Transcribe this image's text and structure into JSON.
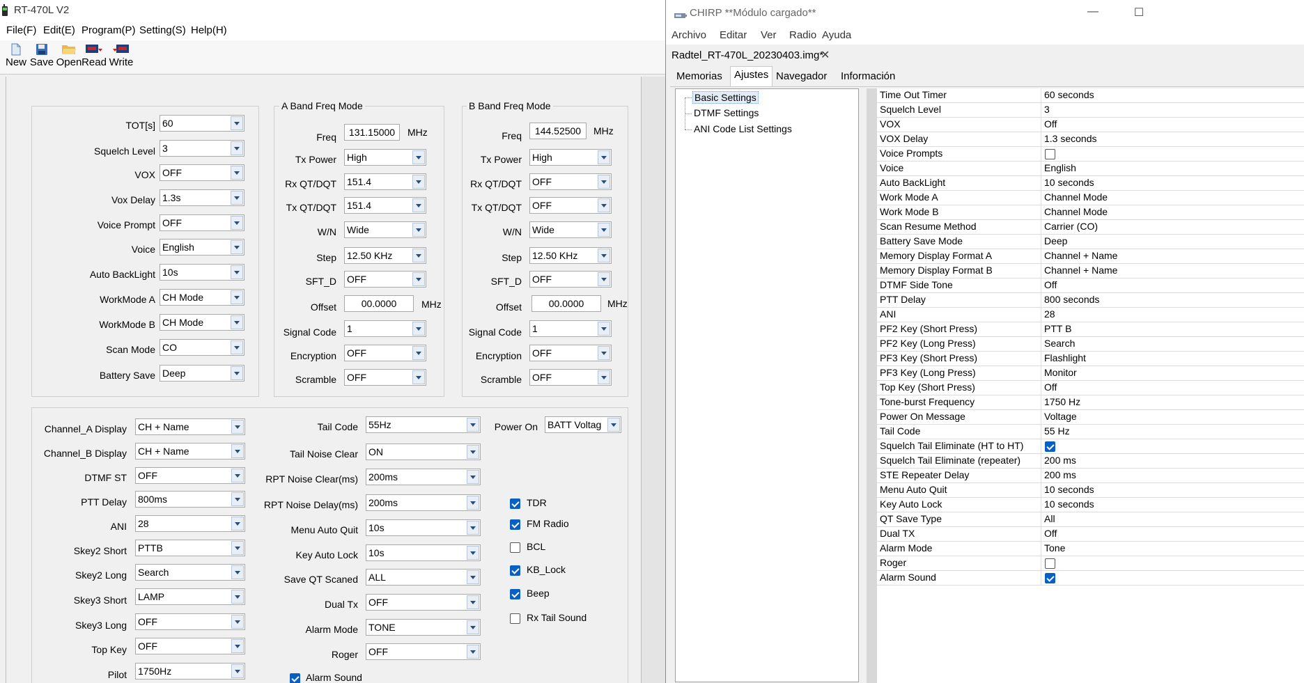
{
  "rt": {
    "title": "RT-470L V2",
    "menu": [
      "File(F)",
      "Edit(E)",
      "Program(P)",
      "Setting(S)",
      "Help(H)"
    ],
    "toolbar": [
      "New",
      "Save",
      "Open",
      "Read",
      "Write"
    ],
    "general": {
      "tot": {
        "label": "TOT[s]",
        "value": "60"
      },
      "squelch": {
        "label": "Squelch Level",
        "value": "3"
      },
      "vox": {
        "label": "VOX",
        "value": "OFF"
      },
      "vox_delay": {
        "label": "Vox Delay",
        "value": "1.3s"
      },
      "voice_prompt": {
        "label": "Voice Prompt",
        "value": "OFF"
      },
      "voice": {
        "label": "Voice",
        "value": "English"
      },
      "backlight": {
        "label": "Auto BackLight",
        "value": "10s"
      },
      "workmode_a": {
        "label": "WorkMode A",
        "value": "CH Mode"
      },
      "workmode_b": {
        "label": "WorkMode B",
        "value": "CH Mode"
      },
      "scan_mode": {
        "label": "Scan Mode",
        "value": "CO"
      },
      "battery_save": {
        "label": "Battery Save",
        "value": "Deep"
      }
    },
    "band_a": {
      "title": "A Band Freq Mode",
      "freq": {
        "label": "Freq",
        "value": "131.15000",
        "unit": "MHz"
      },
      "tx_power": {
        "label": "Tx Power",
        "value": "High"
      },
      "rx_qt": {
        "label": "Rx QT/DQT",
        "value": "151.4"
      },
      "tx_qt": {
        "label": "Tx QT/DQT",
        "value": "151.4"
      },
      "wn": {
        "label": "W/N",
        "value": "Wide"
      },
      "step": {
        "label": "Step",
        "value": "12.50 KHz"
      },
      "sft_d": {
        "label": "SFT_D",
        "value": "OFF"
      },
      "offset": {
        "label": "Offset",
        "value": "00.0000",
        "unit": "MHz"
      },
      "signal_code": {
        "label": "Signal Code",
        "value": "1"
      },
      "encryption": {
        "label": "Encryption",
        "value": "OFF"
      },
      "scramble": {
        "label": "Scramble",
        "value": "OFF"
      }
    },
    "band_b": {
      "title": "B Band Freq Mode",
      "freq": {
        "label": "Freq",
        "value": "144.52500",
        "unit": "MHz"
      },
      "tx_power": {
        "label": "Tx Power",
        "value": "High"
      },
      "rx_qt": {
        "label": "Rx QT/DQT",
        "value": "OFF"
      },
      "tx_qt": {
        "label": "Tx QT/DQT",
        "value": "OFF"
      },
      "wn": {
        "label": "W/N",
        "value": "Wide"
      },
      "step": {
        "label": "Step",
        "value": "12.50 KHz"
      },
      "sft_d": {
        "label": "SFT_D",
        "value": "OFF"
      },
      "offset": {
        "label": "Offset",
        "value": "00.0000",
        "unit": "MHz"
      },
      "signal_code": {
        "label": "Signal Code",
        "value": "1"
      },
      "encryption": {
        "label": "Encryption",
        "value": "OFF"
      },
      "scramble": {
        "label": "Scramble",
        "value": "OFF"
      }
    },
    "func_left": {
      "ch_a_display": {
        "label": "Channel_A Display",
        "value": "CH + Name"
      },
      "ch_b_display": {
        "label": "Channel_B Display",
        "value": "CH + Name"
      },
      "dtmf_st": {
        "label": "DTMF ST",
        "value": "OFF"
      },
      "ptt_delay": {
        "label": "PTT Delay",
        "value": "800ms"
      },
      "ani": {
        "label": "ANI",
        "value": "28"
      },
      "skey2_short": {
        "label": "Skey2 Short",
        "value": "PTTB"
      },
      "skey2_long": {
        "label": "Skey2 Long",
        "value": "Search"
      },
      "skey3_short": {
        "label": "Skey3 Short",
        "value": "LAMP"
      },
      "skey3_long": {
        "label": "Skey3 Long",
        "value": "OFF"
      },
      "top_key": {
        "label": "Top Key",
        "value": "OFF"
      },
      "pilot": {
        "label": "Pilot",
        "value": "1750Hz"
      }
    },
    "func_mid": {
      "tail_code": {
        "label": "Tail Code",
        "value": "55Hz"
      },
      "tail_noise_clear": {
        "label": "Tail Noise Clear",
        "value": "ON"
      },
      "rpt_noise_clear": {
        "label": "RPT Noise Clear(ms)",
        "value": "200ms"
      },
      "rpt_noise_delay": {
        "label": "RPT Noise Delay(ms)",
        "value": "200ms"
      },
      "menu_auto_quit": {
        "label": "Menu Auto Quit",
        "value": "10s"
      },
      "key_auto_lock": {
        "label": "Key Auto Lock",
        "value": "10s"
      },
      "save_qt_scaned": {
        "label": "Save QT Scaned",
        "value": "ALL"
      },
      "dual_tx": {
        "label": "Dual Tx",
        "value": "OFF"
      },
      "alarm_mode": {
        "label": "Alarm Mode",
        "value": "TONE"
      },
      "roger": {
        "label": "Roger",
        "value": "OFF"
      },
      "alarm_sound": {
        "label": "Alarm Sound",
        "checked": true
      }
    },
    "power_on": {
      "label": "Power On",
      "value": "BATT Voltag"
    },
    "checks": [
      {
        "label": "TDR",
        "checked": true
      },
      {
        "label": "FM Radio",
        "checked": true
      },
      {
        "label": "BCL",
        "checked": false
      },
      {
        "label": "KB_Lock",
        "checked": true
      },
      {
        "label": "Beep",
        "checked": true
      },
      {
        "label": "Rx Tail Sound",
        "checked": false
      }
    ]
  },
  "chirp": {
    "title": "CHIRP **Módulo cargado**",
    "menu": [
      "Archivo",
      "Editar",
      "Ver",
      "Radio",
      "Ayuda"
    ],
    "file_tab": "Radtel_RT-470L_20230403.img*",
    "tabs": [
      "Memorias",
      "Ajustes",
      "Navegador",
      "Información"
    ],
    "active_tab": "Ajustes",
    "tree": [
      "Basic Settings",
      "DTMF Settings",
      "ANI Code List Settings"
    ],
    "settings": [
      {
        "k": "Time Out Timer",
        "v": "60 seconds"
      },
      {
        "k": "Squelch Level",
        "v": "3"
      },
      {
        "k": "VOX",
        "v": "Off"
      },
      {
        "k": "VOX Delay",
        "v": "1.3 seconds"
      },
      {
        "k": "Voice Prompts",
        "check": false
      },
      {
        "k": "Voice",
        "v": "English"
      },
      {
        "k": "Auto BackLight",
        "v": "10 seconds"
      },
      {
        "k": "Work Mode A",
        "v": "Channel Mode"
      },
      {
        "k": "Work Mode B",
        "v": "Channel Mode"
      },
      {
        "k": "Scan Resume Method",
        "v": "Carrier (CO)"
      },
      {
        "k": "Battery Save Mode",
        "v": "Deep"
      },
      {
        "k": "Memory Display Format A",
        "v": "Channel + Name"
      },
      {
        "k": "Memory Display Format B",
        "v": "Channel + Name"
      },
      {
        "k": "DTMF Side Tone",
        "v": "Off"
      },
      {
        "k": "PTT Delay",
        "v": "800 seconds"
      },
      {
        "k": "ANI",
        "v": "28"
      },
      {
        "k": "PF2 Key (Short Press)",
        "v": "PTT B"
      },
      {
        "k": "PF2 Key (Long Press)",
        "v": "Search"
      },
      {
        "k": "PF3 Key (Short Press)",
        "v": "Flashlight"
      },
      {
        "k": "PF3 Key (Long Press)",
        "v": "Monitor"
      },
      {
        "k": "Top Key (Short Press)",
        "v": "Off"
      },
      {
        "k": "Tone-burst Frequency",
        "v": "1750 Hz"
      },
      {
        "k": "Power On Message",
        "v": "Voltage"
      },
      {
        "k": "Tail Code",
        "v": "55 Hz"
      },
      {
        "k": "Squelch Tail Eliminate (HT to HT)",
        "check": true
      },
      {
        "k": "Squelch Tail Eliminate (repeater)",
        "v": "200 ms"
      },
      {
        "k": "STE Repeater Delay",
        "v": "200 ms"
      },
      {
        "k": "Menu Auto Quit",
        "v": "10 seconds"
      },
      {
        "k": "Key Auto Lock",
        "v": "10 seconds"
      },
      {
        "k": "QT Save Type",
        "v": "All"
      },
      {
        "k": "Dual TX",
        "v": "Off"
      },
      {
        "k": "Alarm Mode",
        "v": "Tone"
      },
      {
        "k": "Roger",
        "check": false
      },
      {
        "k": "Alarm Sound",
        "check": true
      }
    ]
  }
}
